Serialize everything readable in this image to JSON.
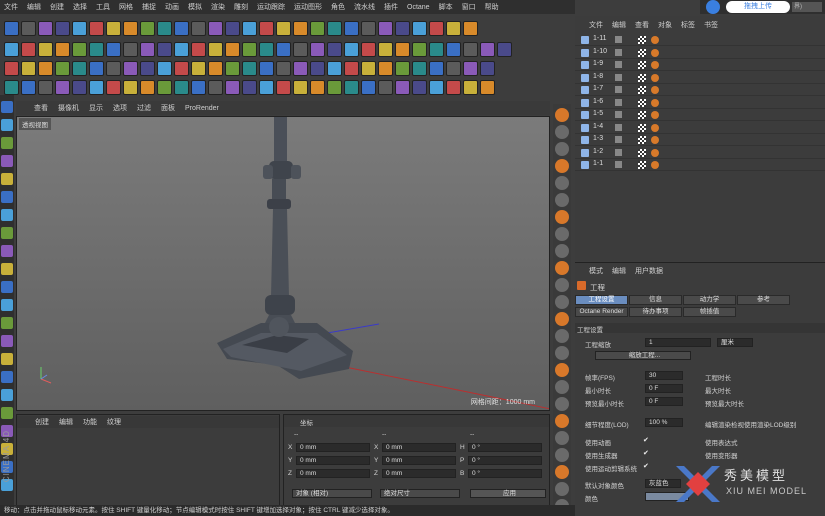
{
  "menubar": [
    "文件",
    "编辑",
    "创建",
    "选择",
    "工具",
    "网格",
    "捕捉",
    "动画",
    "模拟",
    "渲染",
    "雕刻",
    "运动跟踪",
    "运动图形",
    "角色",
    "流水线",
    "插件",
    "Octane",
    "脚本",
    "窗口",
    "帮助"
  ],
  "cloud": {
    "upload_label": "拖拽上传",
    "select_label": "界)"
  },
  "viewport": {
    "menu": [
      "查看",
      "摄像机",
      "显示",
      "选项",
      "过滤",
      "面板",
      "ProRender"
    ],
    "view_label": "透视视图",
    "grid_label": "网格间距：1000 mm"
  },
  "object_manager": {
    "menu": [
      "文件",
      "编辑",
      "查看",
      "对象",
      "标签",
      "书签"
    ],
    "rows": [
      "1-11",
      "1-10",
      "1-9",
      "1-8",
      "1-7",
      "1-6",
      "1-5",
      "1-4",
      "1-3",
      "1-2",
      "1-1"
    ]
  },
  "attributes": {
    "menu": [
      "模式",
      "编辑",
      "用户数据"
    ],
    "title": "工程",
    "tabs_row1": [
      "工程设置",
      "信息",
      "动力学",
      "参考"
    ],
    "tabs_row2": [
      "Octane Render",
      "待办事项",
      "帧插值"
    ],
    "section": "工程设置",
    "scale_label": "工程缩放",
    "scale_value": "1",
    "scale_unit": "厘米",
    "scale_button": "缩放工程...",
    "fps_label": "帧率(FPS)",
    "fps_value": "30",
    "min_time_label": "最小时长",
    "min_time_value": "0 F",
    "preview_min_label": "预览最小时长",
    "preview_min_value": "0 F",
    "project_time_label": "工程时长",
    "max_time_label": "最大时长",
    "preview_max_label": "预览最大时长",
    "lod_label": "细节程度(LOD)",
    "lod_value": "100 %",
    "lod_right_label": "编辑渲染检视使用渲染LOD级别",
    "use_anim_label": "使用动画",
    "use_gen_label": "使用生成器",
    "use_motion_label": "使用运动剪辑系统",
    "use_expr_label": "使用表达式",
    "use_deform_label": "使用变形器",
    "default_color_label": "默认对象颜色",
    "default_color_value": "灰蓝色",
    "color_label": "颜色",
    "check_mark": "✔"
  },
  "bottom_left": {
    "menu": [
      "创建",
      "编辑",
      "功能",
      "纹理"
    ]
  },
  "coords": {
    "title": "坐标",
    "col_heads": [
      "--",
      "--",
      "--"
    ],
    "rows": [
      {
        "a": "X",
        "av": "0 mm",
        "b": "X",
        "bv": "0 mm",
        "c": "H",
        "cv": "0 °"
      },
      {
        "a": "Y",
        "av": "0 mm",
        "b": "Y",
        "bv": "0 mm",
        "c": "P",
        "cv": "0 °"
      },
      {
        "a": "Z",
        "av": "0 mm",
        "b": "Z",
        "bv": "0 mm",
        "c": "B",
        "cv": "0 °"
      }
    ],
    "mode_select": "对象 (相对)",
    "size_select": "绝对尺寸",
    "apply_button": "应用"
  },
  "statusbar": "移动：点击并拖动鼠标移动元素。按住 SHIFT 键量化移动；节点编辑模式时按住 SHIFT 键增加选择对象；按住 CTRL 键减少选择对象。",
  "cinema_logo": "CINEMA 4D",
  "watermark": {
    "cn": "秀美模型",
    "en": "XIU MEI MODEL"
  }
}
